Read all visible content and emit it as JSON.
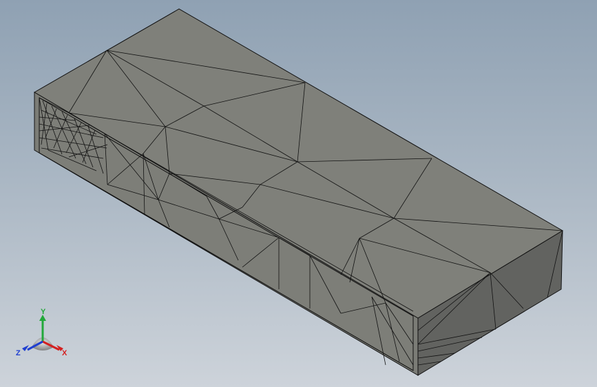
{
  "viewport": {
    "background_top": "#8fa1b3",
    "background_bottom": "#cdd3da"
  },
  "model": {
    "face_top_color": "#7f807a",
    "face_front_color": "#7a7b75",
    "face_end_color": "#626360",
    "edge_color": "#111111"
  },
  "triad": {
    "x_label": "X",
    "y_label": "Y",
    "z_label": "Z",
    "x_color": "#d42020",
    "y_color": "#22a83a",
    "z_color": "#1f3fd0"
  }
}
